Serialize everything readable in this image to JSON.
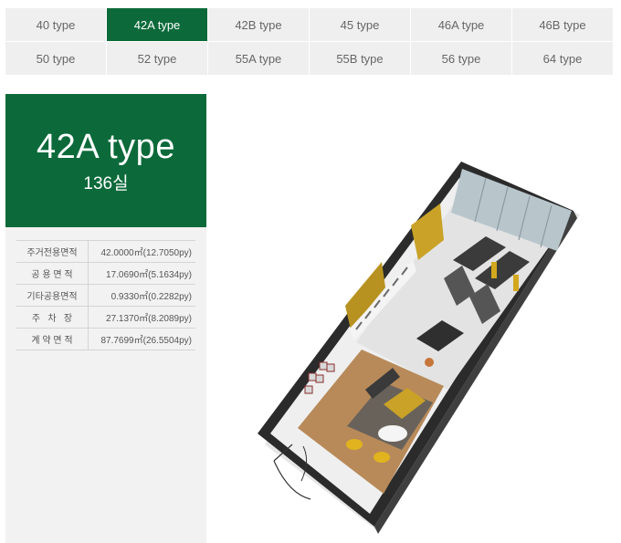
{
  "tabs": [
    {
      "label": "40 type",
      "active": false
    },
    {
      "label": "42A type",
      "active": true
    },
    {
      "label": "42B type",
      "active": false
    },
    {
      "label": "45 type",
      "active": false
    },
    {
      "label": "46A type",
      "active": false
    },
    {
      "label": "46B type",
      "active": false
    },
    {
      "label": "50 type",
      "active": false
    },
    {
      "label": "52 type",
      "active": false
    },
    {
      "label": "55A type",
      "active": false
    },
    {
      "label": "55B type",
      "active": false
    },
    {
      "label": "56 type",
      "active": false
    },
    {
      "label": "64 type",
      "active": false
    }
  ],
  "panel": {
    "title": "42A type",
    "units": "136실",
    "specs": [
      {
        "label": "주거전용면적",
        "value": "42.0000㎡(12.7050py)"
      },
      {
        "label": "공 용 면 적",
        "value": "17.0690㎡(5.1634py)"
      },
      {
        "label": "기타공용면적",
        "value": "0.9330㎡(0.2282py)"
      },
      {
        "label": "주   차   장",
        "value": "27.1370㎡(8.2089py)"
      },
      {
        "label": "계 약 면 적",
        "value": "87.7699㎡(26.5504py)"
      }
    ]
  },
  "colors": {
    "accent": "#0c6a3a",
    "tab_bg": "#efefef",
    "panel_bg": "#f2f2f2"
  }
}
